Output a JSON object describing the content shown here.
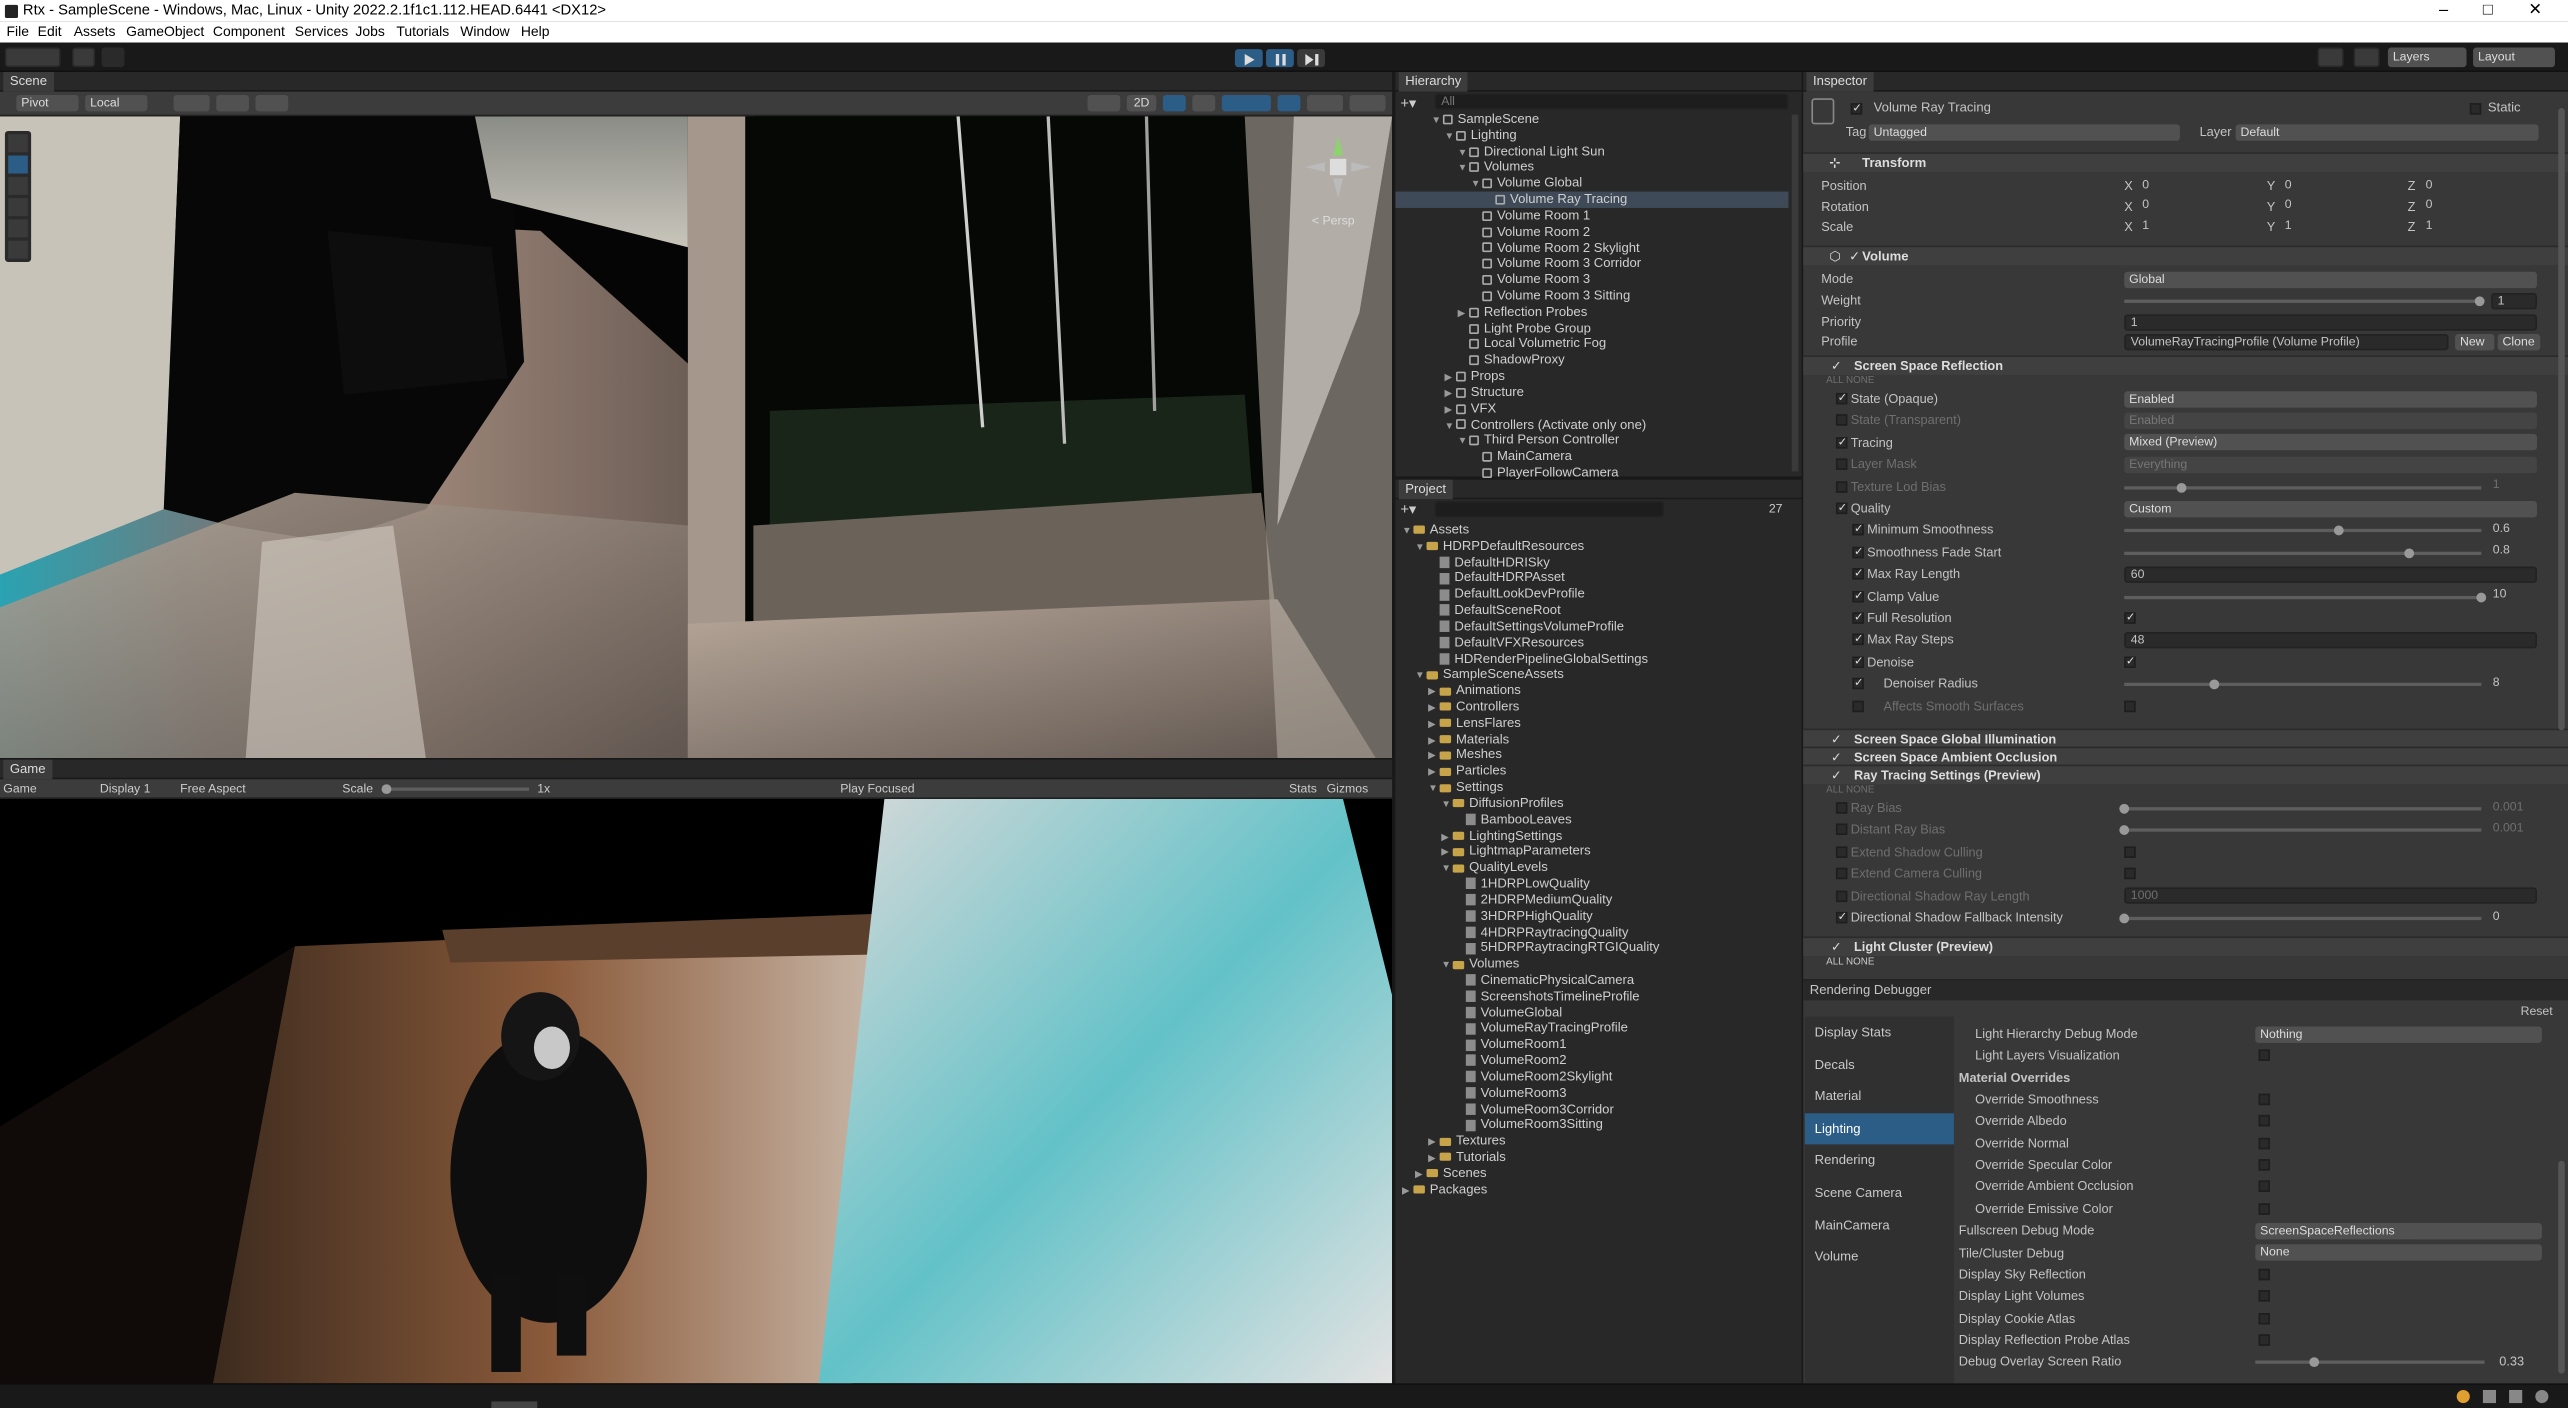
{
  "window": {
    "title": "Rtx - SampleScene - Windows, Mac, Linux - Unity 2022.2.1f1c1.112.HEAD.6441 <DX12>"
  },
  "menu": [
    "File",
    "Edit",
    "Assets",
    "GameObject",
    "Component",
    "Services",
    "Jobs",
    "Tutorials",
    "Window",
    "Help"
  ],
  "toolbar": {
    "layers": "Layers",
    "layout": "Layout"
  },
  "scene": {
    "tab": "Scene",
    "pivot": "Pivot",
    "local": "Local",
    "mode2d": "2D",
    "persp": "< Persp"
  },
  "game": {
    "tab": "Game",
    "mode": "Game",
    "display": "Display 1",
    "aspect": "Free Aspect",
    "scale_label": "Scale",
    "scale_value": "1x",
    "play_focused": "Play Focused",
    "stats": "Stats",
    "gizmos": "Gizmos"
  },
  "hierarchy": {
    "tab": "Hierarchy",
    "search": "All",
    "items": [
      {
        "label": "SampleScene",
        "depth": 0
      },
      {
        "label": "Lighting",
        "depth": 1
      },
      {
        "label": "Directional Light Sun",
        "depth": 2
      },
      {
        "label": "Volumes",
        "depth": 2
      },
      {
        "label": "Volume Global",
        "depth": 3
      },
      {
        "label": "Volume Ray Tracing",
        "depth": 4
      },
      {
        "label": "Volume Room 1",
        "depth": 3
      },
      {
        "label": "Volume Room 2",
        "depth": 3
      },
      {
        "label": "Volume Room 2 Skylight",
        "depth": 3
      },
      {
        "label": "Volume Room 3 Corridor",
        "depth": 3
      },
      {
        "label": "Volume Room 3",
        "depth": 3
      },
      {
        "label": "Volume Room 3 Sitting",
        "depth": 3
      },
      {
        "label": "Reflection Probes",
        "depth": 2
      },
      {
        "label": "Light Probe Group",
        "depth": 2
      },
      {
        "label": "Local Volumetric Fog",
        "depth": 2
      },
      {
        "label": "ShadowProxy",
        "depth": 2
      },
      {
        "label": "Props",
        "depth": 1
      },
      {
        "label": "Structure",
        "depth": 1
      },
      {
        "label": "VFX",
        "depth": 1
      },
      {
        "label": "Controllers (Activate only one)",
        "depth": 1
      },
      {
        "label": "Third Person Controller",
        "depth": 2
      },
      {
        "label": "MainCamera",
        "depth": 3
      },
      {
        "label": "PlayerFollowCamera",
        "depth": 3
      }
    ]
  },
  "project": {
    "tab": "Project",
    "count": "27",
    "items": [
      {
        "label": "Assets",
        "depth": 0,
        "f": 1
      },
      {
        "label": "HDRPDefaultResources",
        "depth": 1,
        "f": 1
      },
      {
        "label": "DefaultHDRISky",
        "depth": 2,
        "f": 0
      },
      {
        "label": "DefaultHDRPAsset",
        "depth": 2,
        "f": 0
      },
      {
        "label": "DefaultLookDevProfile",
        "depth": 2,
        "f": 0
      },
      {
        "label": "DefaultSceneRoot",
        "depth": 2,
        "f": 0
      },
      {
        "label": "DefaultSettingsVolumeProfile",
        "depth": 2,
        "f": 0
      },
      {
        "label": "DefaultVFXResources",
        "depth": 2,
        "f": 0
      },
      {
        "label": "HDRenderPipelineGlobalSettings",
        "depth": 2,
        "f": 0
      },
      {
        "label": "SampleSceneAssets",
        "depth": 1,
        "f": 1
      },
      {
        "label": "Animations",
        "depth": 2,
        "f": 1
      },
      {
        "label": "Controllers",
        "depth": 2,
        "f": 1
      },
      {
        "label": "LensFlares",
        "depth": 2,
        "f": 1
      },
      {
        "label": "Materials",
        "depth": 2,
        "f": 1
      },
      {
        "label": "Meshes",
        "depth": 2,
        "f": 1
      },
      {
        "label": "Particles",
        "depth": 2,
        "f": 1
      },
      {
        "label": "Settings",
        "depth": 2,
        "f": 1
      },
      {
        "label": "DiffusionProfiles",
        "depth": 3,
        "f": 1
      },
      {
        "label": "BambooLeaves",
        "depth": 4,
        "f": 0
      },
      {
        "label": "LightingSettings",
        "depth": 3,
        "f": 1
      },
      {
        "label": "LightmapParameters",
        "depth": 3,
        "f": 1
      },
      {
        "label": "QualityLevels",
        "depth": 3,
        "f": 1
      },
      {
        "label": "1HDRPLowQuality",
        "depth": 4,
        "f": 0
      },
      {
        "label": "2HDRPMediumQuality",
        "depth": 4,
        "f": 0
      },
      {
        "label": "3HDRPHighQuality",
        "depth": 4,
        "f": 0
      },
      {
        "label": "4HDRPRaytracingQuality",
        "depth": 4,
        "f": 0
      },
      {
        "label": "5HDRPRaytracingRTGIQuality",
        "depth": 4,
        "f": 0
      },
      {
        "label": "Volumes",
        "depth": 3,
        "f": 1
      },
      {
        "label": "CinematicPhysicalCamera",
        "depth": 4,
        "f": 0
      },
      {
        "label": "ScreenshotsTimelineProfile",
        "depth": 4,
        "f": 0
      },
      {
        "label": "VolumeGlobal",
        "depth": 4,
        "f": 0
      },
      {
        "label": "VolumeRayTracingProfile",
        "depth": 4,
        "f": 0
      },
      {
        "label": "VolumeRoom1",
        "depth": 4,
        "f": 0
      },
      {
        "label": "VolumeRoom2",
        "depth": 4,
        "f": 0
      },
      {
        "label": "VolumeRoom2Skylight",
        "depth": 4,
        "f": 0
      },
      {
        "label": "VolumeRoom3",
        "depth": 4,
        "f": 0
      },
      {
        "label": "VolumeRoom3Corridor",
        "depth": 4,
        "f": 0
      },
      {
        "label": "VolumeRoom3Sitting",
        "depth": 4,
        "f": 0
      },
      {
        "label": "Textures",
        "depth": 2,
        "f": 1
      },
      {
        "label": "Tutorials",
        "depth": 2,
        "f": 1
      },
      {
        "label": "Scenes",
        "depth": 1,
        "f": 1
      },
      {
        "label": "Packages",
        "depth": 0,
        "f": 1
      }
    ]
  },
  "inspector": {
    "tab": "Inspector",
    "object_name": "Volume Ray Tracing",
    "static": "Static",
    "tag_label": "Tag",
    "tag": "Untagged",
    "layer_label": "Layer",
    "layer": "Default",
    "transform": {
      "title": "Transform",
      "position": "Position",
      "rotation": "Rotation",
      "scale": "Scale",
      "pos": [
        "0",
        "0",
        "0"
      ],
      "rot": [
        "0",
        "0",
        "0"
      ],
      "scl": [
        "1",
        "1",
        "1"
      ],
      "axes": [
        "X",
        "Y",
        "Z"
      ]
    },
    "volume": {
      "title": "Volume",
      "mode_label": "Mode",
      "mode": "Global",
      "weight_label": "Weight",
      "weight": "1",
      "weight_frac": 1,
      "priority_label": "Priority",
      "priority": "1",
      "profile_label": "Profile",
      "profile": "VolumeRayTracingProfile (Volume Profile)",
      "new": "New",
      "clone": "Clone"
    },
    "all": "ALL",
    "none": "NONE",
    "ssr": {
      "title": "Screen Space Reflection",
      "rows": [
        {
          "label": "State (Opaque)",
          "value": "Enabled",
          "kind": "dd",
          "on": true
        },
        {
          "label": "State (Transparent)",
          "value": "Enabled",
          "kind": "dd",
          "on": false,
          "dim": true
        },
        {
          "label": "Tracing",
          "value": "Mixed (Preview)",
          "kind": "dd",
          "on": true
        },
        {
          "label": "Layer Mask",
          "value": "Everything",
          "kind": "dd",
          "on": false,
          "dim": true
        },
        {
          "label": "Texture Lod Bias",
          "value": "1",
          "kind": "sl",
          "on": false,
          "dim": true,
          "frac": 0.16
        },
        {
          "label": "Quality",
          "value": "Custom",
          "kind": "dd",
          "on": true
        },
        {
          "label": "Minimum Smoothness",
          "value": "0.6",
          "kind": "sl",
          "on": true,
          "frac": 0.6,
          "sub": 1
        },
        {
          "label": "Smoothness Fade Start",
          "value": "0.8",
          "kind": "sl",
          "on": true,
          "frac": 0.8,
          "sub": 1
        },
        {
          "label": "Max Ray Length",
          "value": "60",
          "kind": "fld",
          "on": true,
          "sub": 1
        },
        {
          "label": "Clamp Value",
          "value": "10",
          "kind": "sl",
          "on": true,
          "frac": 1,
          "sub": 1
        },
        {
          "label": "Full Resolution",
          "value": "✓",
          "kind": "cb",
          "on": true,
          "sub": 1
        },
        {
          "label": "Max Ray Steps",
          "value": "48",
          "kind": "fld",
          "on": true,
          "sub": 1
        },
        {
          "label": "Denoise",
          "value": "✓",
          "kind": "cb",
          "on": true,
          "sub": 1
        },
        {
          "label": "Denoiser Radius",
          "value": "8",
          "kind": "sl",
          "on": true,
          "frac": 0.25,
          "sub": 2
        },
        {
          "label": "Affects Smooth Surfaces",
          "value": "",
          "kind": "cb",
          "on": false,
          "dim": true,
          "sub": 2
        }
      ]
    },
    "ssgi": "Screen Space Global Illumination",
    "ssao": "Screen Space Ambient Occlusion",
    "rts": {
      "title": "Ray Tracing Settings (Preview)",
      "rows": [
        {
          "label": "Ray Bias",
          "value": "0.001",
          "kind": "sl",
          "dim": true,
          "frac": 0
        },
        {
          "label": "Distant Ray Bias",
          "value": "0.001",
          "kind": "sl",
          "dim": true,
          "frac": 0
        },
        {
          "label": "Extend Shadow Culling",
          "value": "",
          "kind": "cb",
          "dim": true
        },
        {
          "label": "Extend Camera Culling",
          "value": "",
          "kind": "cb",
          "dim": true
        },
        {
          "label": "Directional Shadow Ray Length",
          "value": "1000",
          "kind": "fld",
          "dim": true
        },
        {
          "label": "Directional Shadow Fallback Intensity",
          "value": "0",
          "kind": "sl",
          "on": true,
          "frac": 0
        }
      ]
    },
    "lc": "Light Cluster (Preview)"
  },
  "debugger": {
    "title": "Rendering Debugger",
    "reset": "Reset",
    "panels": [
      "Display Stats",
      "Decals",
      "Material",
      "Lighting",
      "Rendering",
      "Scene Camera",
      "MainCamera",
      "Volume"
    ],
    "selected": 3,
    "rows": [
      {
        "label": "Light Hierarchy Debug Mode",
        "value": "Nothing",
        "kind": "dd",
        "ind": 1
      },
      {
        "label": "Light Layers Visualization",
        "value": "",
        "kind": "cb",
        "ind": 1
      },
      {
        "label": "Material Overrides",
        "value": "",
        "kind": "hdr",
        "ind": 0
      },
      {
        "label": "Override Smoothness",
        "value": "",
        "kind": "cb",
        "ind": 1
      },
      {
        "label": "Override Albedo",
        "value": "",
        "kind": "cb",
        "ind": 1
      },
      {
        "label": "Override Normal",
        "value": "",
        "kind": "cb",
        "ind": 1
      },
      {
        "label": "Override Specular Color",
        "value": "",
        "kind": "cb",
        "ind": 1
      },
      {
        "label": "Override Ambient Occlusion",
        "value": "",
        "kind": "cb",
        "ind": 1
      },
      {
        "label": "Override Emissive Color",
        "value": "",
        "kind": "cb",
        "ind": 1
      },
      {
        "label": "Fullscreen Debug Mode",
        "value": "ScreenSpaceReflections",
        "kind": "dd",
        "ind": 0
      },
      {
        "label": "Tile/Cluster Debug",
        "value": "None",
        "kind": "dd",
        "ind": 0
      },
      {
        "label": "Display Sky Reflection",
        "value": "",
        "kind": "cb",
        "ind": 0
      },
      {
        "label": "Display Light Volumes",
        "value": "",
        "kind": "cb",
        "ind": 0
      },
      {
        "label": "Display Cookie Atlas",
        "value": "",
        "kind": "cb",
        "ind": 0
      },
      {
        "label": "Display Reflection Probe Atlas",
        "value": "",
        "kind": "cb",
        "ind": 0
      },
      {
        "label": "Debug Overlay Screen Ratio",
        "value": "0.33",
        "kind": "sl",
        "ind": 0,
        "frac": 0.26
      }
    ]
  },
  "colors": {
    "accent": "#2c5d87",
    "bg": "#383838",
    "dark": "#191919"
  }
}
